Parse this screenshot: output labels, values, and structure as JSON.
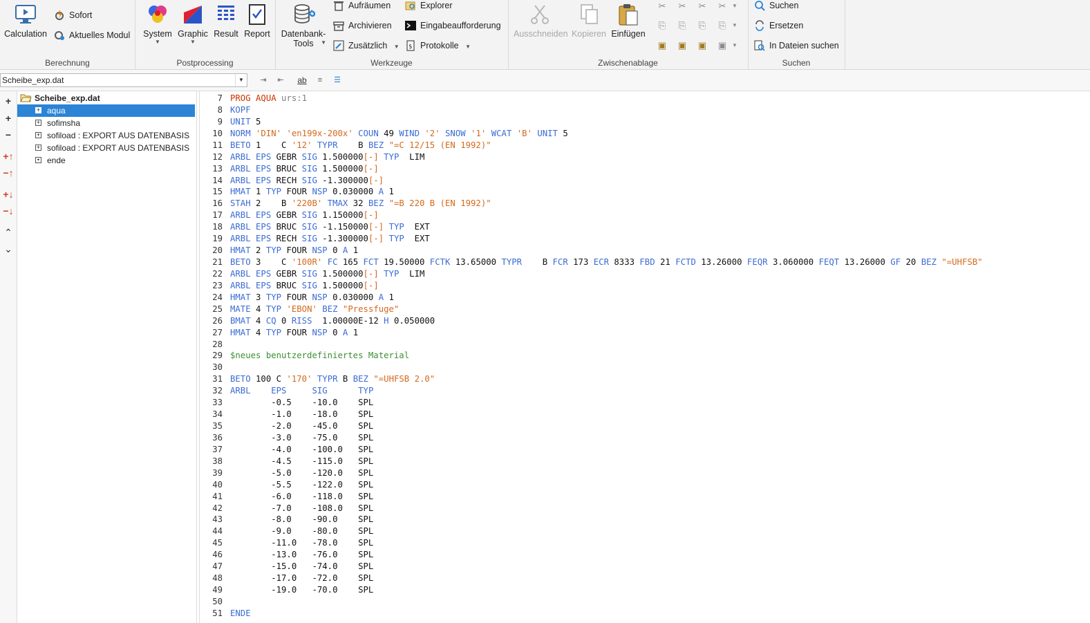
{
  "ribbon": {
    "berechnung": {
      "label": "Berechnung",
      "calculation": "Calculation",
      "sofort": "Sofort",
      "aktuelles_modul": "Aktuelles Modul"
    },
    "postprocessing": {
      "label": "Postprocessing",
      "system": "System",
      "graphic": "Graphic",
      "result": "Result",
      "report": "Report"
    },
    "werkzeuge": {
      "label": "Werkzeuge",
      "datenbank_line1": "Datenbank-",
      "datenbank_line2": "Tools",
      "aufraeumen": "Aufräumen",
      "archivieren": "Archivieren",
      "zusaetzlich": "Zusätzlich",
      "explorer": "Explorer",
      "eingabeaufforderung": "Eingabeaufforderung",
      "protokolle": "Protokolle"
    },
    "zwischenablage": {
      "label": "Zwischenablage",
      "ausschneiden": "Ausschneiden",
      "kopieren": "Kopieren",
      "einfuegen": "Einfügen"
    },
    "suchen": {
      "label": "Suchen",
      "suchen": "Suchen",
      "ersetzen": "Ersetzen",
      "in_dateien_suchen": "In Dateien suchen"
    }
  },
  "toolbar": {
    "file_combo": "Scheibe_exp.dat"
  },
  "tree": {
    "root": "Scheibe_exp.dat",
    "items": [
      {
        "label": "aqua",
        "selected": true,
        "expander": "+"
      },
      {
        "label": "sofimsha",
        "selected": false,
        "expander": "+"
      },
      {
        "label": "sofiload : EXPORT AUS DATENBASIS",
        "selected": false,
        "expander": "+"
      },
      {
        "label": "sofiload : EXPORT AUS DATENBASIS",
        "selected": false,
        "expander": "+"
      },
      {
        "label": "ende",
        "selected": false,
        "expander": "•"
      }
    ]
  },
  "editor": {
    "lines": [
      {
        "n": 7,
        "tokens": [
          [
            "PROG",
            "r"
          ],
          [
            " ",
            "t"
          ],
          [
            "AQUA",
            "r"
          ],
          [
            " urs:1",
            "g"
          ]
        ]
      },
      {
        "n": 8,
        "tokens": [
          [
            "KOPF",
            "k"
          ]
        ]
      },
      {
        "n": 9,
        "tokens": [
          [
            "UNIT",
            "k"
          ],
          [
            " 5",
            "t"
          ]
        ]
      },
      {
        "n": 10,
        "tokens": [
          [
            "NORM",
            "k"
          ],
          [
            " ",
            "t"
          ],
          [
            "'DIN'",
            "s"
          ],
          [
            " ",
            "t"
          ],
          [
            "'en199x-200x'",
            "s"
          ],
          [
            " ",
            "t"
          ],
          [
            "COUN",
            "k"
          ],
          [
            " 49 ",
            "t"
          ],
          [
            "WIND",
            "k"
          ],
          [
            " ",
            "t"
          ],
          [
            "'2'",
            "s"
          ],
          [
            " ",
            "t"
          ],
          [
            "SNOW",
            "k"
          ],
          [
            " ",
            "t"
          ],
          [
            "'1'",
            "s"
          ],
          [
            " ",
            "t"
          ],
          [
            "WCAT",
            "k"
          ],
          [
            " ",
            "t"
          ],
          [
            "'B'",
            "s"
          ],
          [
            " ",
            "t"
          ],
          [
            "UNIT",
            "k"
          ],
          [
            " 5",
            "t"
          ]
        ]
      },
      {
        "n": 11,
        "tokens": [
          [
            "BETO",
            "k"
          ],
          [
            " 1    C ",
            "t"
          ],
          [
            "'12'",
            "s"
          ],
          [
            " ",
            "t"
          ],
          [
            "TYPR",
            "k"
          ],
          [
            "    B ",
            "t"
          ],
          [
            "BEZ",
            "k"
          ],
          [
            " ",
            "t"
          ],
          [
            "\"=C 12/15 (EN 1992)\"",
            "s"
          ]
        ]
      },
      {
        "n": 12,
        "tokens": [
          [
            "ARBL",
            "k"
          ],
          [
            " ",
            "t"
          ],
          [
            "EPS",
            "k"
          ],
          [
            " GEBR ",
            "t"
          ],
          [
            "SIG",
            "k"
          ],
          [
            " 1.500000",
            "t"
          ],
          [
            "[-]",
            "s"
          ],
          [
            " ",
            "t"
          ],
          [
            "TYP",
            "k"
          ],
          [
            "  LIM",
            "t"
          ]
        ]
      },
      {
        "n": 13,
        "tokens": [
          [
            "ARBL",
            "k"
          ],
          [
            " ",
            "t"
          ],
          [
            "EPS",
            "k"
          ],
          [
            " BRUC ",
            "t"
          ],
          [
            "SIG",
            "k"
          ],
          [
            " 1.500000",
            "t"
          ],
          [
            "[-]",
            "s"
          ]
        ]
      },
      {
        "n": 14,
        "tokens": [
          [
            "ARBL",
            "k"
          ],
          [
            " ",
            "t"
          ],
          [
            "EPS",
            "k"
          ],
          [
            " RECH ",
            "t"
          ],
          [
            "SIG",
            "k"
          ],
          [
            " -1.300000",
            "t"
          ],
          [
            "[-]",
            "s"
          ]
        ]
      },
      {
        "n": 15,
        "tokens": [
          [
            "HMAT",
            "k"
          ],
          [
            " 1 ",
            "t"
          ],
          [
            "TYP",
            "k"
          ],
          [
            " FOUR ",
            "t"
          ],
          [
            "NSP",
            "k"
          ],
          [
            " 0.030000 ",
            "t"
          ],
          [
            "A",
            "k"
          ],
          [
            " 1",
            "t"
          ]
        ]
      },
      {
        "n": 16,
        "tokens": [
          [
            "STAH",
            "k"
          ],
          [
            " 2    B ",
            "t"
          ],
          [
            "'220B'",
            "s"
          ],
          [
            " ",
            "t"
          ],
          [
            "TMAX",
            "k"
          ],
          [
            " 32 ",
            "t"
          ],
          [
            "BEZ",
            "k"
          ],
          [
            " ",
            "t"
          ],
          [
            "\"=B 220 B (EN 1992)\"",
            "s"
          ]
        ]
      },
      {
        "n": 17,
        "tokens": [
          [
            "ARBL",
            "k"
          ],
          [
            " ",
            "t"
          ],
          [
            "EPS",
            "k"
          ],
          [
            " GEBR ",
            "t"
          ],
          [
            "SIG",
            "k"
          ],
          [
            " 1.150000",
            "t"
          ],
          [
            "[-]",
            "s"
          ]
        ]
      },
      {
        "n": 18,
        "tokens": [
          [
            "ARBL",
            "k"
          ],
          [
            " ",
            "t"
          ],
          [
            "EPS",
            "k"
          ],
          [
            " BRUC ",
            "t"
          ],
          [
            "SIG",
            "k"
          ],
          [
            " -1.150000",
            "t"
          ],
          [
            "[-]",
            "s"
          ],
          [
            " ",
            "t"
          ],
          [
            "TYP",
            "k"
          ],
          [
            "  EXT",
            "t"
          ]
        ]
      },
      {
        "n": 19,
        "tokens": [
          [
            "ARBL",
            "k"
          ],
          [
            " ",
            "t"
          ],
          [
            "EPS",
            "k"
          ],
          [
            " RECH ",
            "t"
          ],
          [
            "SIG",
            "k"
          ],
          [
            " -1.300000",
            "t"
          ],
          [
            "[-]",
            "s"
          ],
          [
            " ",
            "t"
          ],
          [
            "TYP",
            "k"
          ],
          [
            "  EXT",
            "t"
          ]
        ]
      },
      {
        "n": 20,
        "tokens": [
          [
            "HMAT",
            "k"
          ],
          [
            " 2 ",
            "t"
          ],
          [
            "TYP",
            "k"
          ],
          [
            " FOUR ",
            "t"
          ],
          [
            "NSP",
            "k"
          ],
          [
            " 0 ",
            "t"
          ],
          [
            "A",
            "k"
          ],
          [
            " 1",
            "t"
          ]
        ]
      },
      {
        "n": 21,
        "tokens": [
          [
            "BETO",
            "k"
          ],
          [
            " 3    C ",
            "t"
          ],
          [
            "'100R'",
            "s"
          ],
          [
            " ",
            "t"
          ],
          [
            "FC",
            "k"
          ],
          [
            " 165 ",
            "t"
          ],
          [
            "FCT",
            "k"
          ],
          [
            " 19.50000 ",
            "t"
          ],
          [
            "FCTK",
            "k"
          ],
          [
            " 13.65000 ",
            "t"
          ],
          [
            "TYPR",
            "k"
          ],
          [
            "    B ",
            "t"
          ],
          [
            "FCR",
            "k"
          ],
          [
            " 173 ",
            "t"
          ],
          [
            "ECR",
            "k"
          ],
          [
            " 8333 ",
            "t"
          ],
          [
            "FBD",
            "k"
          ],
          [
            " 21 ",
            "t"
          ],
          [
            "FCTD",
            "k"
          ],
          [
            " 13.26000 ",
            "t"
          ],
          [
            "FEQR",
            "k"
          ],
          [
            " 3.060000 ",
            "t"
          ],
          [
            "FEQT",
            "k"
          ],
          [
            " 13.26000 ",
            "t"
          ],
          [
            "GF",
            "k"
          ],
          [
            " 20 ",
            "t"
          ],
          [
            "BEZ",
            "k"
          ],
          [
            " ",
            "t"
          ],
          [
            "\"=UHFSB\"",
            "s"
          ]
        ]
      },
      {
        "n": 22,
        "tokens": [
          [
            "ARBL",
            "k"
          ],
          [
            " ",
            "t"
          ],
          [
            "EPS",
            "k"
          ],
          [
            " GEBR ",
            "t"
          ],
          [
            "SIG",
            "k"
          ],
          [
            " 1.500000",
            "t"
          ],
          [
            "[-]",
            "s"
          ],
          [
            " ",
            "t"
          ],
          [
            "TYP",
            "k"
          ],
          [
            "  LIM",
            "t"
          ]
        ]
      },
      {
        "n": 23,
        "tokens": [
          [
            "ARBL",
            "k"
          ],
          [
            " ",
            "t"
          ],
          [
            "EPS",
            "k"
          ],
          [
            " BRUC ",
            "t"
          ],
          [
            "SIG",
            "k"
          ],
          [
            " 1.500000",
            "t"
          ],
          [
            "[-]",
            "s"
          ]
        ]
      },
      {
        "n": 24,
        "tokens": [
          [
            "HMAT",
            "k"
          ],
          [
            " 3 ",
            "t"
          ],
          [
            "TYP",
            "k"
          ],
          [
            " FOUR ",
            "t"
          ],
          [
            "NSP",
            "k"
          ],
          [
            " 0.030000 ",
            "t"
          ],
          [
            "A",
            "k"
          ],
          [
            " 1",
            "t"
          ]
        ]
      },
      {
        "n": 25,
        "tokens": [
          [
            "MATE",
            "k"
          ],
          [
            " 4 ",
            "t"
          ],
          [
            "TYP",
            "k"
          ],
          [
            " ",
            "t"
          ],
          [
            "'EBON'",
            "s"
          ],
          [
            " ",
            "t"
          ],
          [
            "BEZ",
            "k"
          ],
          [
            " ",
            "t"
          ],
          [
            "\"Pressfuge\"",
            "s"
          ]
        ]
      },
      {
        "n": 26,
        "tokens": [
          [
            "BMAT",
            "k"
          ],
          [
            " 4 ",
            "t"
          ],
          [
            "CQ",
            "k"
          ],
          [
            " 0 ",
            "t"
          ],
          [
            "RISS",
            "k"
          ],
          [
            "  1.00000E-12 ",
            "t"
          ],
          [
            "H",
            "k"
          ],
          [
            " 0.050000",
            "t"
          ]
        ]
      },
      {
        "n": 27,
        "tokens": [
          [
            "HMAT",
            "k"
          ],
          [
            " 4 ",
            "t"
          ],
          [
            "TYP",
            "k"
          ],
          [
            " FOUR ",
            "t"
          ],
          [
            "NSP",
            "k"
          ],
          [
            " 0 ",
            "t"
          ],
          [
            "A",
            "k"
          ],
          [
            " 1",
            "t"
          ]
        ]
      },
      {
        "n": 28,
        "tokens": []
      },
      {
        "n": 29,
        "tokens": [
          [
            "$neues benutzerdefiniertes Material",
            "c"
          ]
        ]
      },
      {
        "n": 30,
        "tokens": []
      },
      {
        "n": 31,
        "tokens": [
          [
            "BETO",
            "k"
          ],
          [
            " 100 C ",
            "t"
          ],
          [
            "'170'",
            "s"
          ],
          [
            " ",
            "t"
          ],
          [
            "TYPR",
            "k"
          ],
          [
            " B ",
            "t"
          ],
          [
            "BEZ",
            "k"
          ],
          [
            " ",
            "t"
          ],
          [
            "\"=UHFSB 2.0\"",
            "s"
          ]
        ]
      },
      {
        "n": 32,
        "tokens": [
          [
            "ARBL",
            "k"
          ],
          [
            "    ",
            "t"
          ],
          [
            "EPS",
            "k"
          ],
          [
            "     ",
            "t"
          ],
          [
            "SIG",
            "k"
          ],
          [
            "      ",
            "t"
          ],
          [
            "TYP",
            "k"
          ]
        ]
      },
      {
        "n": 33,
        "tokens": [
          [
            "        -0.5    -10.0    SPL",
            "t"
          ]
        ]
      },
      {
        "n": 34,
        "tokens": [
          [
            "        -1.0    -18.0    SPL",
            "t"
          ]
        ]
      },
      {
        "n": 35,
        "tokens": [
          [
            "        -2.0    -45.0    SPL",
            "t"
          ]
        ]
      },
      {
        "n": 36,
        "tokens": [
          [
            "        -3.0    -75.0    SPL",
            "t"
          ]
        ]
      },
      {
        "n": 37,
        "tokens": [
          [
            "        -4.0    -100.0   SPL",
            "t"
          ]
        ]
      },
      {
        "n": 38,
        "tokens": [
          [
            "        -4.5    -115.0   SPL",
            "t"
          ]
        ]
      },
      {
        "n": 39,
        "tokens": [
          [
            "        -5.0    -120.0   SPL",
            "t"
          ]
        ]
      },
      {
        "n": 40,
        "tokens": [
          [
            "        -5.5    -122.0   SPL",
            "t"
          ]
        ]
      },
      {
        "n": 41,
        "tokens": [
          [
            "        -6.0    -118.0   SPL",
            "t"
          ]
        ]
      },
      {
        "n": 42,
        "tokens": [
          [
            "        -7.0    -108.0   SPL",
            "t"
          ]
        ]
      },
      {
        "n": 43,
        "tokens": [
          [
            "        -8.0    -90.0    SPL",
            "t"
          ]
        ]
      },
      {
        "n": 44,
        "tokens": [
          [
            "        -9.0    -80.0    SPL",
            "t"
          ]
        ]
      },
      {
        "n": 45,
        "tokens": [
          [
            "        -11.0   -78.0    SPL",
            "t"
          ]
        ]
      },
      {
        "n": 46,
        "tokens": [
          [
            "        -13.0   -76.0    SPL",
            "t"
          ]
        ]
      },
      {
        "n": 47,
        "tokens": [
          [
            "        -15.0   -74.0    SPL",
            "t"
          ]
        ]
      },
      {
        "n": 48,
        "tokens": [
          [
            "        -17.0   -72.0    SPL",
            "t"
          ]
        ]
      },
      {
        "n": 49,
        "tokens": [
          [
            "        -19.0   -70.0    SPL",
            "t"
          ]
        ]
      },
      {
        "n": 50,
        "tokens": []
      },
      {
        "n": 51,
        "tokens": [
          [
            "ENDE",
            "k"
          ]
        ]
      }
    ]
  }
}
